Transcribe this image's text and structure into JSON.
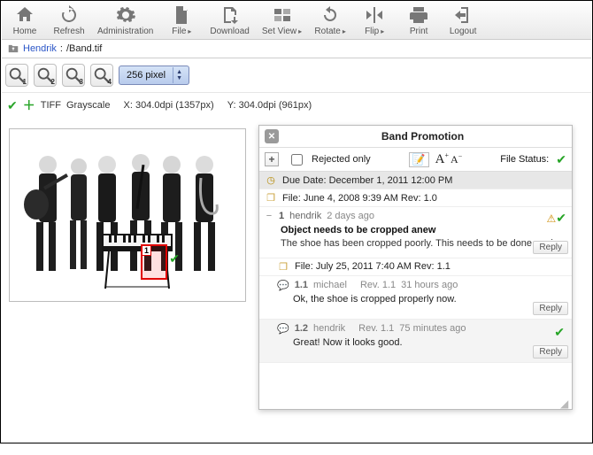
{
  "toolbar": {
    "home": "Home",
    "refresh": "Refresh",
    "administration": "Administration",
    "file": "File",
    "download": "Download",
    "setview": "Set View",
    "rotate": "Rotate",
    "flip": "Flip",
    "print": "Print",
    "logout": "Logout"
  },
  "path": {
    "user": "Hendrik",
    "sep": ": ",
    "file": "/Band.tif"
  },
  "zoom": {
    "b1": "1",
    "b2": "2",
    "b3": "3",
    "b4": "4",
    "select_label": "256 pixel"
  },
  "meta": {
    "format": "TIFF",
    "color": "Grayscale",
    "x": "X: 304.0dpi (1357px)",
    "y": "Y: 304.0dpi (961px)"
  },
  "preview": {
    "marker_num": "1"
  },
  "panel": {
    "title": "Band Promotion",
    "add": "+",
    "rejected_only": "Rejected only",
    "font_edit": "✎",
    "font_big": "A⁺",
    "font_small": "A⁻",
    "file_status_label": "File Status:",
    "due": "Due Date: December 1, 2011 12:00 PM",
    "file1": "File: June 4, 2008 9:39 AM  Rev: 1.0",
    "entry": {
      "handle": "−",
      "num": "1",
      "user": "hendrik",
      "time": "2 days ago",
      "title": "Object needs to be cropped anew",
      "body": "The shoe has been cropped poorly. This needs to be done again.",
      "reply": "Reply"
    },
    "file2": "File: July 25, 2011 7:40 AM  Rev: 1.1",
    "child1": {
      "num": "1.1",
      "user": "michael",
      "rev": "Rev. 1.1",
      "time": "31 hours ago",
      "msg": "Ok, the shoe is cropped properly now.",
      "reply": "Reply"
    },
    "child2": {
      "num": "1.2",
      "user": "hendrik",
      "rev": "Rev. 1.1",
      "time": "75 minutes ago",
      "msg": "Great! Now it looks good.",
      "reply": "Reply"
    }
  }
}
